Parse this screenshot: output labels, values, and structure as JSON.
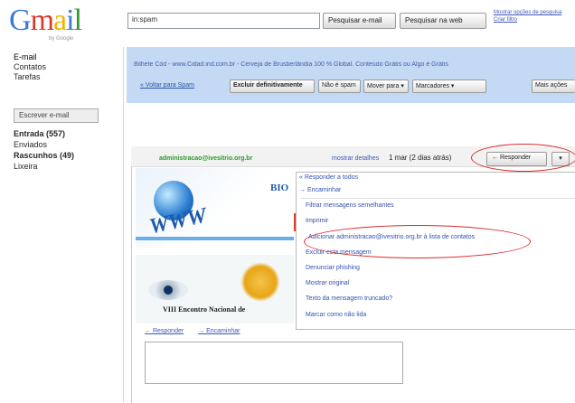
{
  "app": {
    "logo_text": "Gmail",
    "logo_sub": "by Google"
  },
  "search": {
    "value": "in:spam",
    "search_mail_label": "Pesquisar e-mail",
    "search_web_label": "Pesquisar na web",
    "options_label": "Mostrar opções de pesquisa Criar filtro"
  },
  "nav": {
    "items": [
      "E-mail",
      "Contatos",
      "Tarefas"
    ]
  },
  "compose_label": "Escrever e-mail",
  "folders": [
    {
      "label": "Entrada (557)",
      "bold": true
    },
    {
      "label": "Enviados",
      "bold": false
    },
    {
      "label": "Rascunhos (49)",
      "bold": true
    },
    {
      "label": "Lixeira",
      "bold": false
    }
  ],
  "banner": {
    "ad_text": "Bilhete Cód - www.Cidad.ind.com.br - Cerveja de Brusberlândia 100 % Global. Conteúdo Grátis ou Algo é Grátis"
  },
  "toolbar": {
    "back_label": "« Voltar para Spam",
    "report_label": "Excluir definitivamente",
    "notspam_label": "Não é spam",
    "moveto_label": "Mover para ▾",
    "labels_label": "Marcadores ▾",
    "more_label": "Mais ações"
  },
  "message": {
    "sender": "administracao@ivesitrio.org.br",
    "show_details": "mostrar detalhes",
    "date": "1 mar (2 dias atrás)",
    "reply_label": "← Responder",
    "reply_more": "▾",
    "image1_label": "BIO",
    "image1_www": "WWW",
    "image2_caption": "VIII Encontro Nacional de"
  },
  "menu": {
    "reply_all": "« Responder a todos",
    "forward": "→ Encaminhar",
    "filter": "Filtrar mensagens semelhantes",
    "print": "Imprimir",
    "add_to": "Adicionar administracao@ivesitrio.org.br à lista de contatos",
    "delete": "Excluir esta mensagem",
    "phishing": "Denunciar phishing",
    "original": "Mostrar original",
    "garbled": "Texto da mensagem truncado?",
    "unread": "Marcar como não lida"
  },
  "reply_links": {
    "reply": "← Responder",
    "forward": "→ Encaminhar"
  },
  "colors": {
    "banner": "#c4d9f3",
    "annotation": "#d82b2b",
    "link": "#3451b2"
  }
}
